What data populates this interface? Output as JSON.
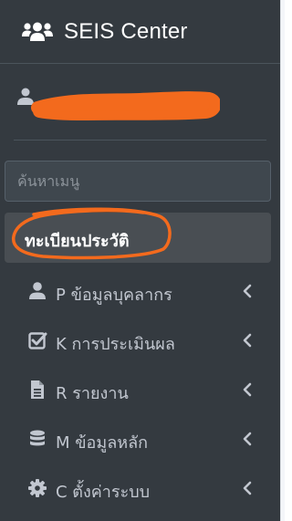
{
  "brand": {
    "name": "SEIS Center",
    "icon": "users-icon"
  },
  "user": {
    "name": "",
    "icon": "user-icon"
  },
  "search": {
    "placeholder": "ค้นหาเมนู",
    "value": ""
  },
  "active_item": {
    "label": "ทะเบียนประวัติ"
  },
  "menu": [
    {
      "label": "P ข้อมูลบุคลากร",
      "icon": "user-icon"
    },
    {
      "label": "K การประเมินผล",
      "icon": "check-square-icon"
    },
    {
      "label": "R รายงาน",
      "icon": "file-text-icon"
    },
    {
      "label": "M ข้อมูลหลัก",
      "icon": "database-icon"
    },
    {
      "label": "C ตั้งค่าระบบ",
      "icon": "cog-icon"
    }
  ],
  "colors": {
    "sidebar_bg": "#343a40",
    "text": "#c2c7d0",
    "active_bg": "#494e53",
    "annotation": "#f36a1d"
  }
}
